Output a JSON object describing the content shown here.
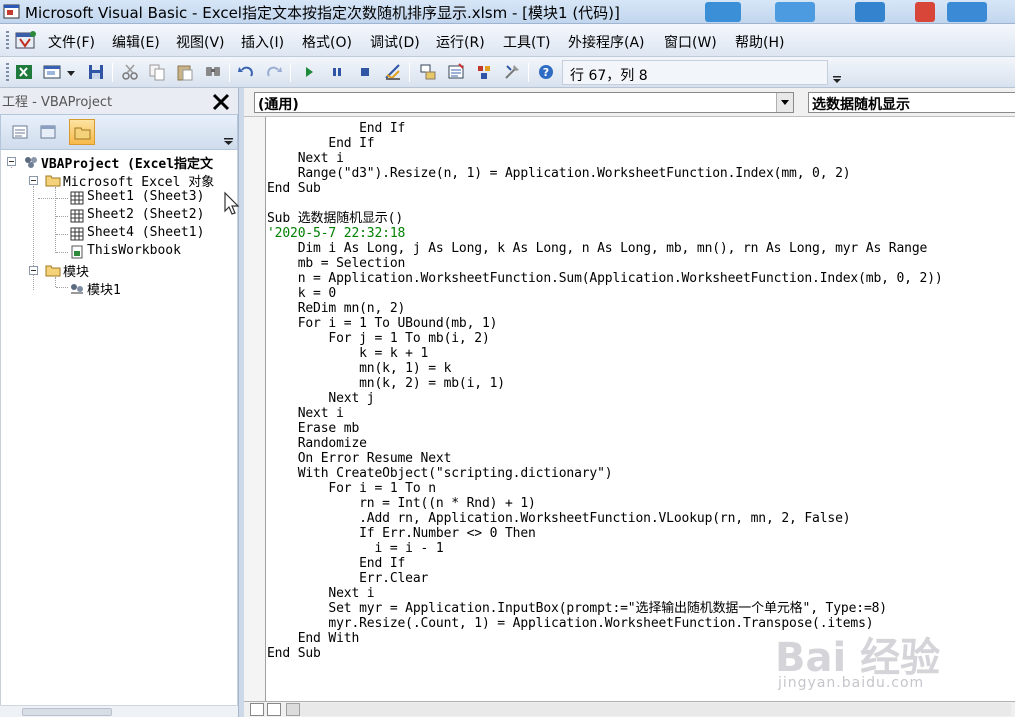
{
  "window": {
    "title": "Microsoft Visual Basic - Excel指定文本按指定次数随机排序显示.xlsm - [模块1 (代码)]"
  },
  "menu": [
    "文件(F)",
    "编辑(E)",
    "视图(V)",
    "插入(I)",
    "格式(O)",
    "调试(D)",
    "运行(R)",
    "工具(T)",
    "外接程序(A)",
    "窗口(W)",
    "帮助(H)"
  ],
  "toolbar": {
    "position": "行 67，列 8",
    "icons": [
      "excel-icon",
      "insert-userform-icon",
      "dropdown-icon",
      "save-icon",
      "cut-icon",
      "copy-icon",
      "paste-icon",
      "find-icon",
      "undo-icon",
      "redo-icon",
      "run-icon",
      "break-icon",
      "reset-icon",
      "design-mode-icon",
      "project-explorer-icon",
      "properties-icon",
      "object-browser-icon",
      "toolbox-icon",
      "help-icon"
    ]
  },
  "project_panel": {
    "title": "工程 - VBAProject",
    "tree": {
      "root": "VBAProject (Excel指定文",
      "excel_objects": "Microsoft Excel 对象",
      "sheets": [
        "Sheet1 (Sheet3)",
        "Sheet2 (Sheet2)",
        "Sheet4 (Sheet1)"
      ],
      "workbook": "ThisWorkbook",
      "modules_folder": "模块",
      "module": "模块1"
    }
  },
  "code_window": {
    "object_combo": "(通用)",
    "procedure_combo": "选数据随机显示",
    "lines": [
      "            End If",
      "        End If",
      "    Next i",
      "    Range(\"d3\").Resize(n, 1) = Application.WorksheetFunction.Index(mm, 0, 2)",
      "End Sub",
      "",
      "Sub 选数据随机显示()",
      "'2020-5-7 22:32:18",
      "    Dim i As Long, j As Long, k As Long, n As Long, mb, mn(), rn As Long, myr As Range",
      "    mb = Selection",
      "    n = Application.WorksheetFunction.Sum(Application.WorksheetFunction.Index(mb, 0, 2))",
      "    k = 0",
      "    ReDim mn(n, 2)",
      "    For i = 1 To UBound(mb, 1)",
      "        For j = 1 To mb(i, 2)",
      "            k = k + 1",
      "            mn(k, 1) = k",
      "            mn(k, 2) = mb(i, 1)",
      "        Next j",
      "    Next i",
      "    Erase mb",
      "    Randomize",
      "    On Error Resume Next",
      "    With CreateObject(\"scripting.dictionary\")",
      "        For i = 1 To n",
      "            rn = Int((n * Rnd) + 1)",
      "            .Add rn, Application.WorksheetFunction.VLookup(rn, mn, 2, False)",
      "            If Err.Number <> 0 Then",
      "              i = i - 1",
      "            End If",
      "            Err.Clear",
      "        Next i",
      "        Set myr = Application.InputBox(prompt:=\"选择输出随机数据一个单元格\", Type:=8)",
      "        myr.Resize(.Count, 1) = Application.WorksheetFunction.Transpose(.items)",
      "    End With",
      "End Sub"
    ]
  },
  "watermark": {
    "brand": "Bai 经验",
    "url": "jingyan.baidu.com"
  }
}
